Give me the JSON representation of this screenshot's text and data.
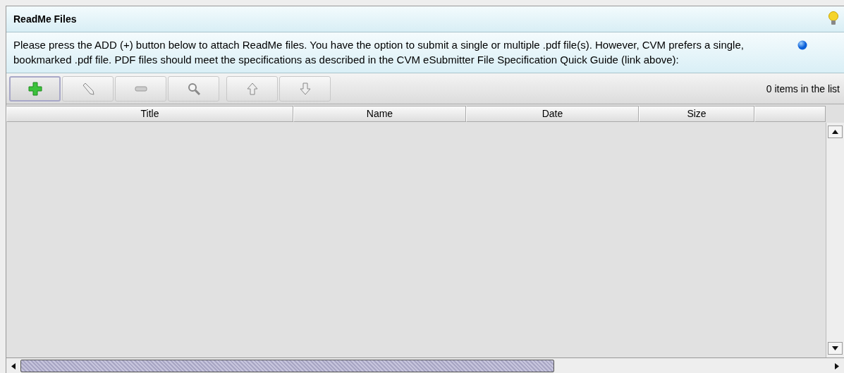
{
  "panel": {
    "title": "ReadMe Files",
    "description": "Please press the ADD (+) button below to attach ReadMe files. You have the option to submit a single or multiple .pdf file(s). However, CVM prefers a single, bookmarked .pdf file. PDF files should meet the specifications as described in the CVM eSubmitter File Specification Quick Guide (link above):"
  },
  "toolbar": {
    "buttons": [
      {
        "kind": "add",
        "selected": true
      },
      {
        "kind": "edit",
        "selected": false
      },
      {
        "kind": "remove",
        "selected": false
      },
      {
        "kind": "view",
        "selected": false
      },
      {
        "kind": "up",
        "selected": false
      },
      {
        "kind": "down",
        "selected": false
      }
    ],
    "count": "0 items in the list"
  },
  "table": {
    "columns": [
      "Title",
      "Name",
      "Date",
      "Size"
    ]
  }
}
